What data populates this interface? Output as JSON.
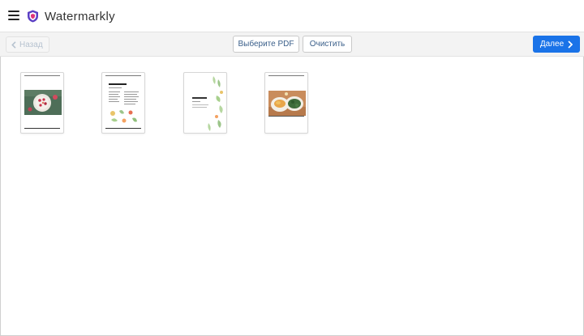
{
  "app": {
    "title": "Watermarkly",
    "logo_icon": "shield-icon",
    "menu_icon": "hamburger-menu-icon",
    "brand_color": "#5b3fc4"
  },
  "toolbar": {
    "back_label": "Назад",
    "select_pdf_label": "Выберите PDF",
    "clear_label": "Очистить",
    "next_label": "Далее",
    "accent_color": "#1a73e8"
  },
  "pages": [
    {
      "content": "photo-fruit-bowl"
    },
    {
      "content": "recipe-text-with-vegetables",
      "heading": "ПОХЛЕБКА"
    },
    {
      "content": "title-with-herb-illustrations"
    },
    {
      "content": "photo-food-plates"
    }
  ]
}
